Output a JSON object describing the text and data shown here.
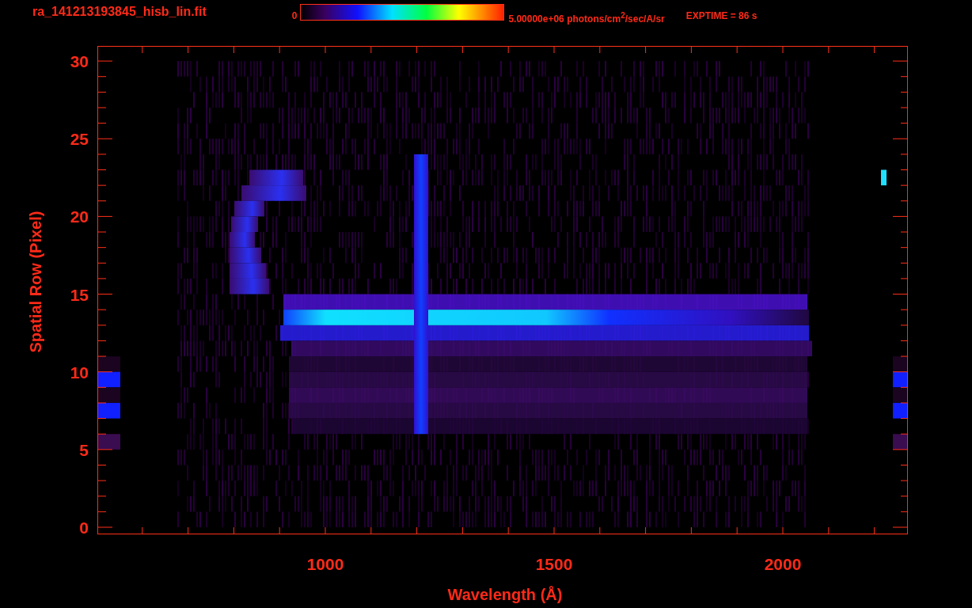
{
  "header": {
    "file_name": "ra_141213193845_hisb_lin.fit",
    "colorbar_min": "0",
    "colorbar_max": "5.00000e+06 photons/cm$^{2}$/sec/A/sr",
    "exposure": "EXPTIME = 86 s"
  },
  "plot": {
    "y_label": "Spatial Row (Pixel)",
    "y_ticks": [
      "30",
      "25",
      "20",
      "15",
      "10",
      "5",
      "0"
    ],
    "x_label": "Wavelength (Å)",
    "x_ticks": [
      "1000",
      "1500",
      "2000"
    ]
  }
}
